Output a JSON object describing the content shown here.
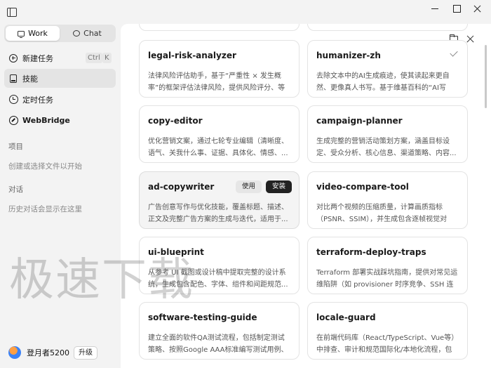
{
  "sidebar": {
    "segment": {
      "work_label": "Work",
      "chat_label": "Chat"
    },
    "nav": {
      "new_task": "新建任务",
      "new_task_shortcut_ctrl": "Ctrl",
      "new_task_shortcut_key": "K",
      "skills": "技能",
      "scheduled": "定时任务",
      "webbridge": "WebBridge"
    },
    "projects_title": "项目",
    "projects_hint": "创建或选择文件以开始",
    "chats_title": "对话",
    "chats_hint": "历史对话会显示在这里",
    "user_name": "登月者5200",
    "upgrade_label": "升级"
  },
  "cards": [
    {
      "title": "legal-risk-analyzer",
      "desc": "法律风险评估助手，基于“严重性 × 发生概率”的框架评估法律风险，提供风险评分、等级..."
    },
    {
      "title": "humanizer-zh",
      "desc": "去除文本中的AI生成痕迹，使其读起来更自然、更像真人书写。基于维基百科的“AI写作..."
    },
    {
      "title": "copy-editor",
      "desc": "优化营销文案，通过七轮专业编辑（清晰度、语气、关我什么事、证据、具体化、情感、..."
    },
    {
      "title": "campaign-planner",
      "desc": "生成完整的营销活动策划方案，涵盖目标设定、受众分析、核心信息、渠道策略、内容..."
    },
    {
      "title": "ad-copywriter",
      "desc": "广告创意写作与优化技能，覆盖标题、描述、正文及完整广告方案的生成与迭代，适用于..."
    },
    {
      "title": "video-compare-tool",
      "desc": "对比两个视频的压缩质量，计算画质指标（PSNR、SSIM），并生成包含逐帧视觉对比..."
    },
    {
      "title": "ui-blueprint",
      "desc": "从参考 UI 截图或设计稿中提取完整的设计系统，生成包含配色、字体、组件和间距规范..."
    },
    {
      "title": "terraform-deploy-traps",
      "desc": "Terraform 部署实战踩坑指南，提供对常见运维陷阱（如 provisioner 时序竞争、SSH 连接冲..."
    },
    {
      "title": "software-testing-guide",
      "desc": "建立全面的软件QA测试流程，包括制定测试策略、按照Google AAA标准编写测试用例、执..."
    },
    {
      "title": "locale-guard",
      "desc": "在前端代码库（React/TypeScript、Vue等）中排查、审计和规范国际化/本地化流程，包括..."
    }
  ],
  "card_actions": {
    "use_label": "使用",
    "install_label": "安装"
  },
  "watermark": "极速下载"
}
